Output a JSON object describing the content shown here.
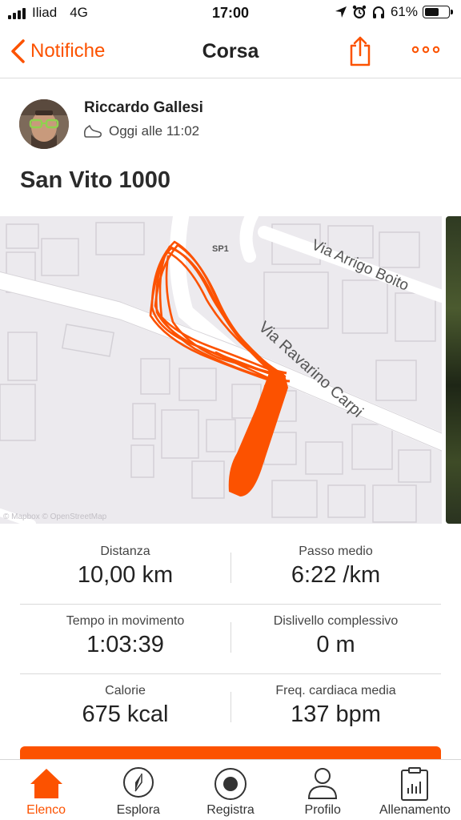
{
  "status_bar": {
    "carrier": "Iliad",
    "network": "4G",
    "time": "17:00",
    "battery": "61%",
    "battery_level": 0.61
  },
  "nav": {
    "back_label": "Notifiche",
    "title": "Corsa",
    "share_icon": "share-icon",
    "more_icon": "more-icon"
  },
  "athlete": {
    "name": "Riccardo Gallesi",
    "time": "Oggi alle 11:02",
    "sport_icon": "shoe-icon"
  },
  "activity": {
    "title": "San Vito 1000"
  },
  "map": {
    "streets": [
      "SP1",
      "Via Arrigo Boito",
      "Via Ravarino Carpi"
    ],
    "route_color": "#fc5200"
  },
  "stats": [
    {
      "left": {
        "label": "Distanza",
        "value": "10,00 km"
      },
      "right": {
        "label": "Passo medio",
        "value": "6:22 /km"
      }
    },
    {
      "left": {
        "label": "Tempo in movimento",
        "value": "1:03:39"
      },
      "right": {
        "label": "Dislivello complessivo",
        "value": "0 m"
      }
    },
    {
      "left": {
        "label": "Calorie",
        "value": "675 kcal"
      },
      "right": {
        "label": "Freq. cardiaca media",
        "value": "137 bpm"
      }
    }
  ],
  "tabs": [
    {
      "label": "Elenco",
      "icon": "home-icon",
      "active": true
    },
    {
      "label": "Esplora",
      "icon": "compass-icon",
      "active": false
    },
    {
      "label": "Registra",
      "icon": "record-icon",
      "active": false
    },
    {
      "label": "Profilo",
      "icon": "profile-icon",
      "active": false
    },
    {
      "label": "Allenamento",
      "icon": "clipboard-chart-icon",
      "active": false
    }
  ],
  "colors": {
    "accent": "#fc5200",
    "text": "#222222",
    "divider": "#dadada"
  }
}
